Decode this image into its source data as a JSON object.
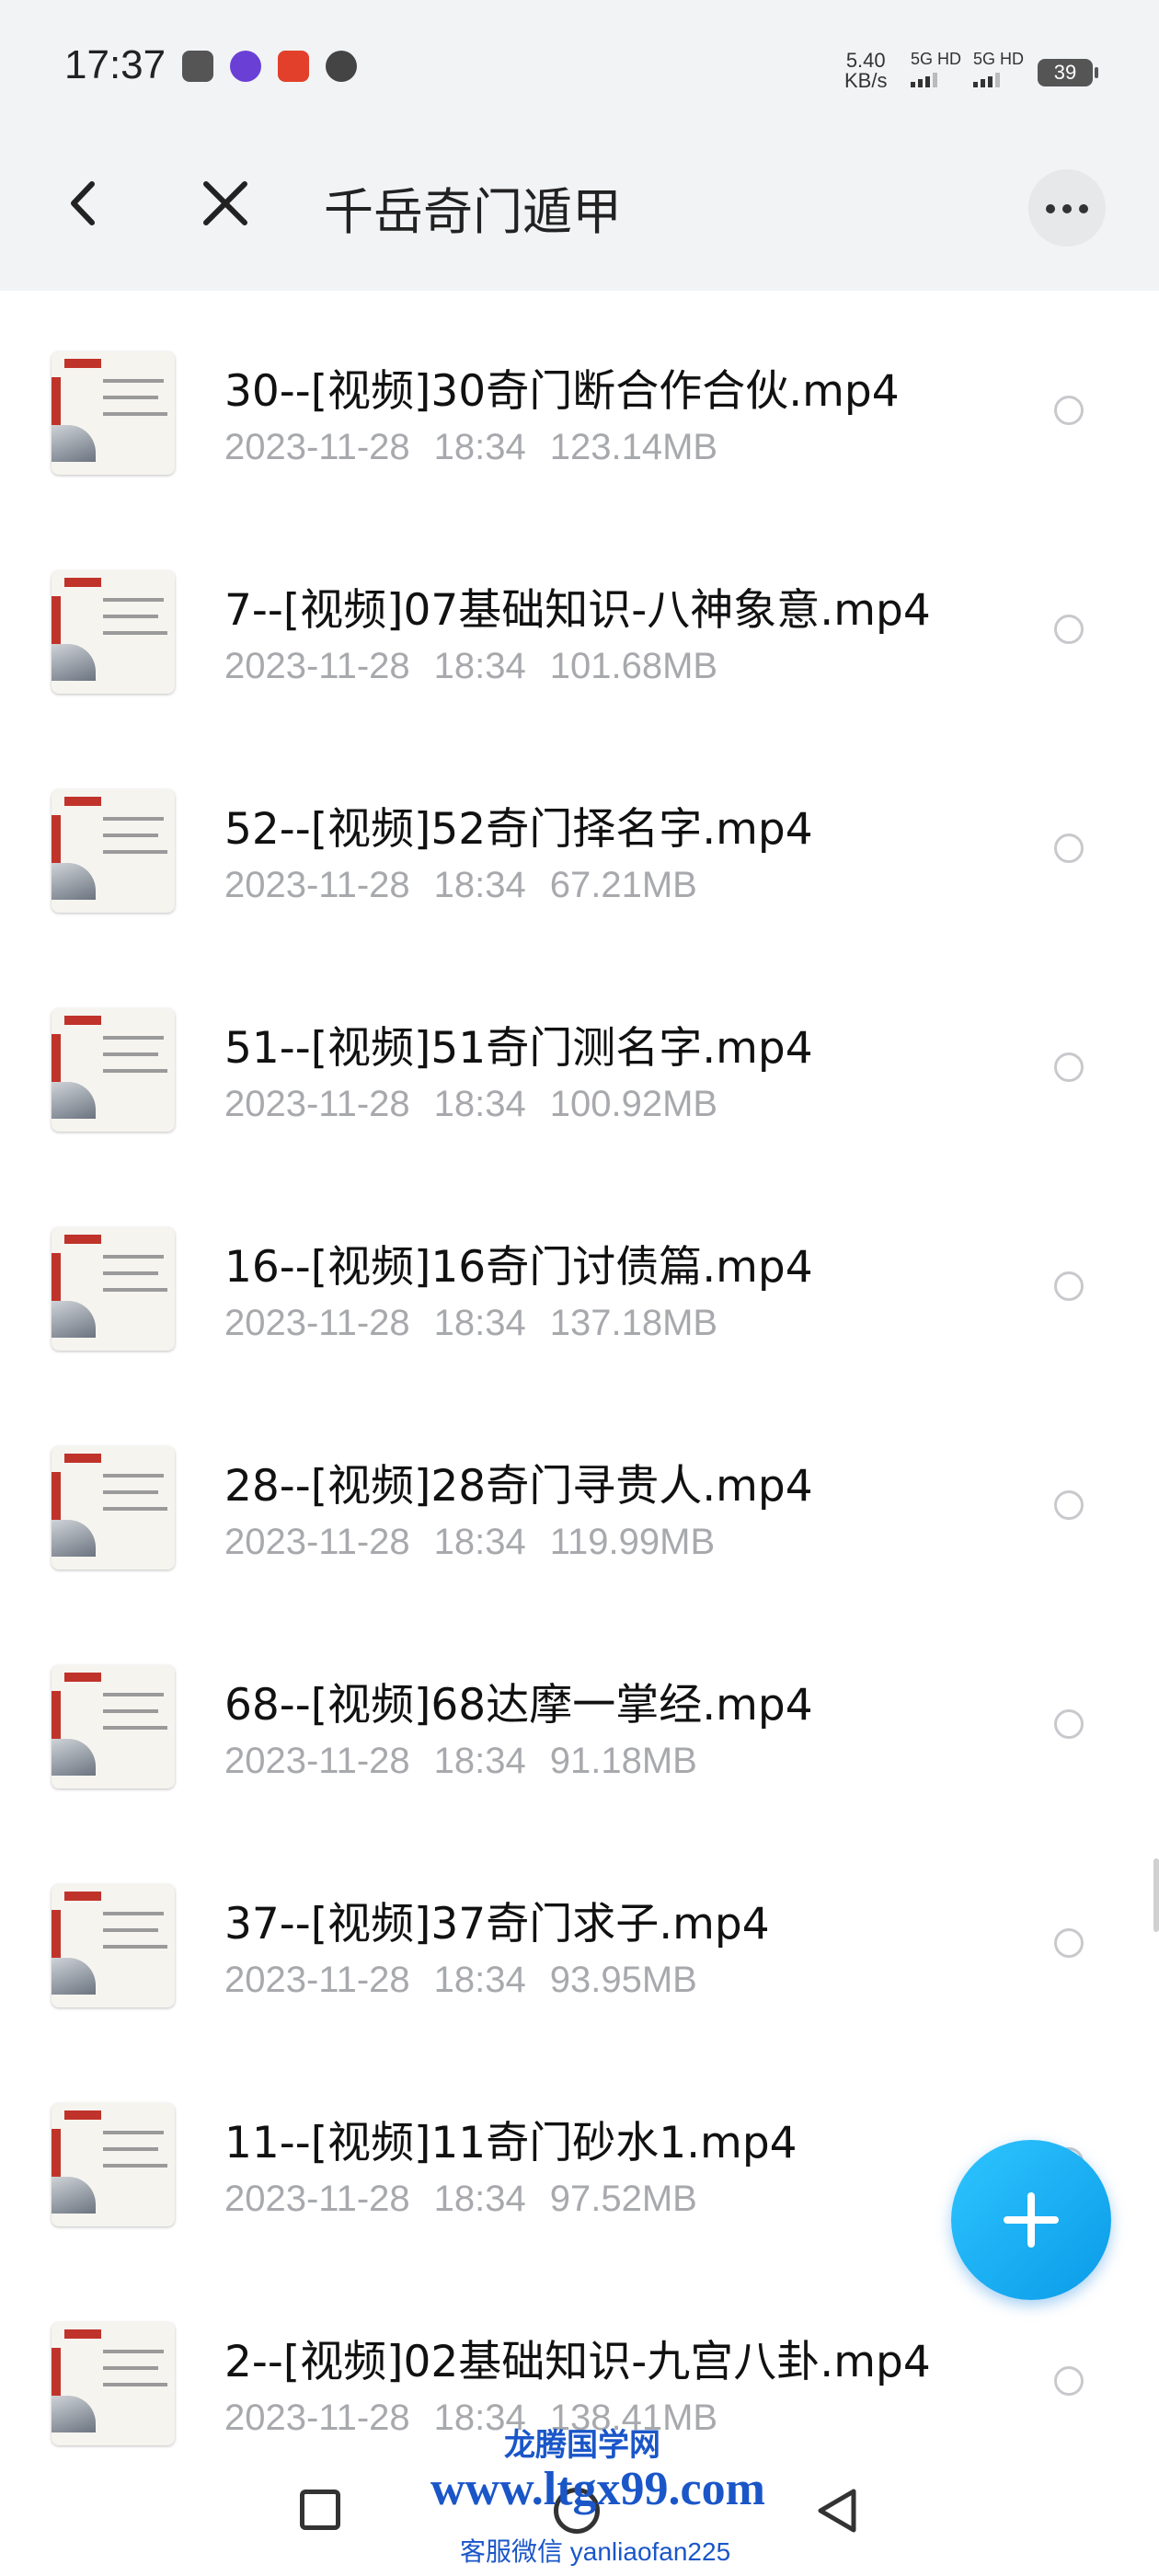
{
  "status_bar": {
    "time": "17:37",
    "net_speed_value": "5.40",
    "net_speed_unit": "KB/s",
    "sim1": "5G HD",
    "sim2": "5G HD",
    "battery": "39"
  },
  "header": {
    "title": "千岳奇门遁甲",
    "back_icon": "chevron-left-icon",
    "close_icon": "close-icon",
    "more_icon": "more-horizontal-icon"
  },
  "files": [
    {
      "name": "30--[视频]30奇门断合作合伙.mp4",
      "date": "2023-11-28",
      "time": "18:34",
      "size": "123.14MB"
    },
    {
      "name": "7--[视频]07基础知识-八神象意.mp4",
      "date": "2023-11-28",
      "time": "18:34",
      "size": "101.68MB"
    },
    {
      "name": "52--[视频]52奇门择名字.mp4",
      "date": "2023-11-28",
      "time": "18:34",
      "size": "67.21MB"
    },
    {
      "name": "51--[视频]51奇门测名字.mp4",
      "date": "2023-11-28",
      "time": "18:34",
      "size": "100.92MB"
    },
    {
      "name": "16--[视频]16奇门讨债篇.mp4",
      "date": "2023-11-28",
      "time": "18:34",
      "size": "137.18MB"
    },
    {
      "name": "28--[视频]28奇门寻贵人.mp4",
      "date": "2023-11-28",
      "time": "18:34",
      "size": "119.99MB"
    },
    {
      "name": "68--[视频]68达摩一掌经.mp4",
      "date": "2023-11-28",
      "time": "18:34",
      "size": "91.18MB"
    },
    {
      "name": "37--[视频]37奇门求子.mp4",
      "date": "2023-11-28",
      "time": "18:34",
      "size": "93.95MB"
    },
    {
      "name": "11--[视频]11奇门砂水1.mp4",
      "date": "2023-11-28",
      "time": "18:34",
      "size": "97.52MB"
    },
    {
      "name": "2--[视频]02基础知识-九宫八卦.mp4",
      "date": "2023-11-28",
      "time": "18:34",
      "size": "138.41MB"
    }
  ],
  "fab": {
    "icon": "plus-icon",
    "color": "#1aaef5"
  },
  "watermark": {
    "title": "龙腾国学网",
    "url": "www.ltgx99.com",
    "contact": "客服微信 yanliaofan225"
  },
  "nav": {
    "recents_icon": "square-icon",
    "home_icon": "circle-icon",
    "back_icon": "triangle-back-icon"
  }
}
